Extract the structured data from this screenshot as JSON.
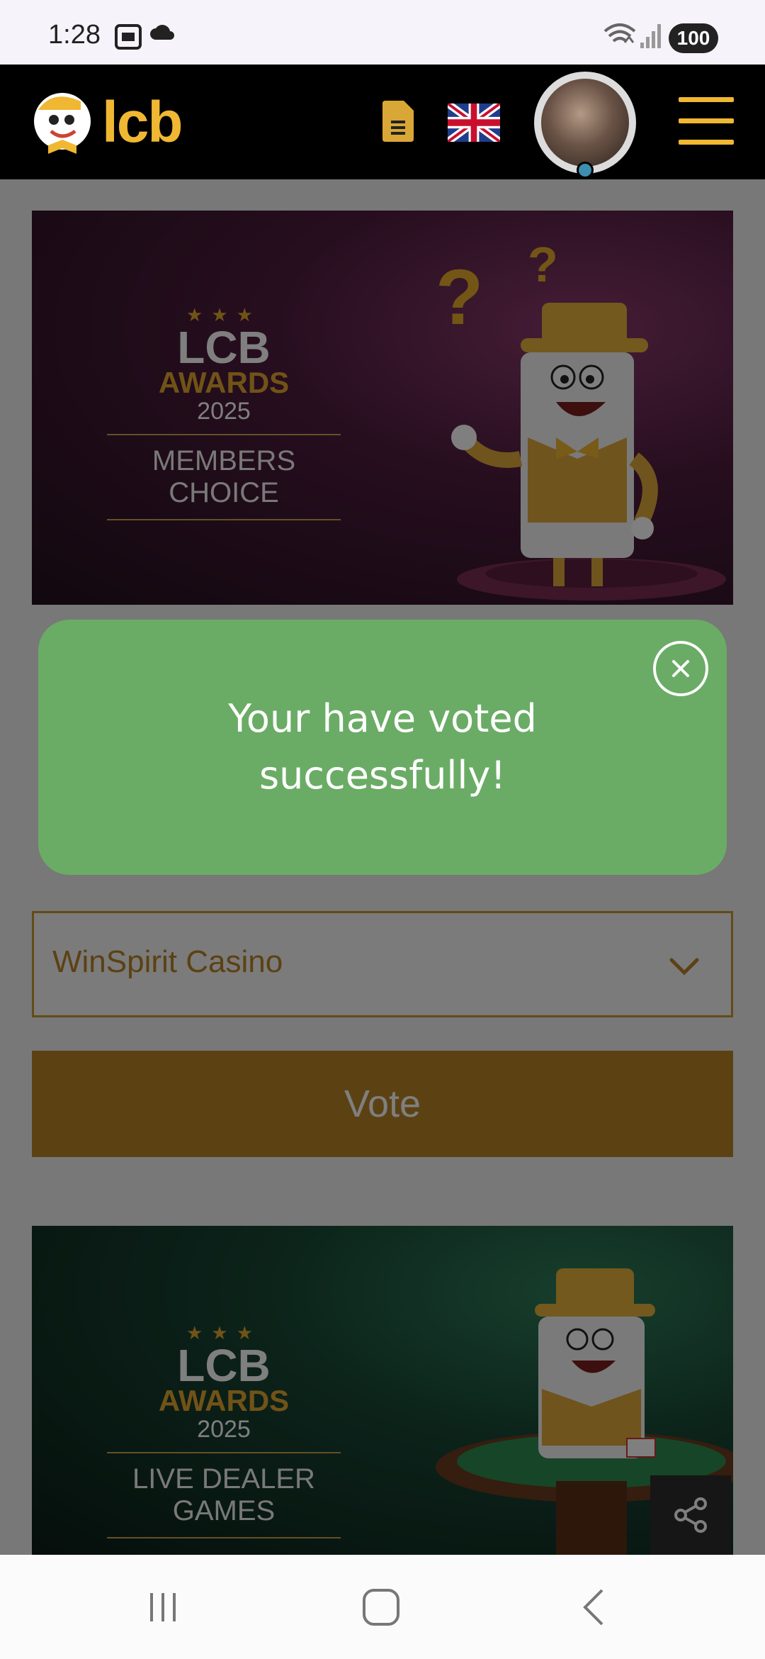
{
  "status_bar": {
    "time": "1:28",
    "battery": "100",
    "icons": [
      "screenshot-icon",
      "cloud-icon",
      "wifi-icon",
      "signal-icon"
    ]
  },
  "header": {
    "logo_text": "lcb",
    "brand_color": "#f0b733",
    "icons": [
      "document-icon",
      "uk-flag-icon",
      "avatar",
      "hamburger-menu-icon"
    ]
  },
  "banners": [
    {
      "lcb": "LCB",
      "awards": "AWARDS",
      "year": "2025",
      "category_line1": "MEMBERS",
      "category_line2": "CHOICE",
      "bg_color": "#4d1c3d"
    },
    {
      "lcb": "LCB",
      "awards": "AWARDS",
      "year": "2025",
      "category_line1": "LIVE DEALER",
      "category_line2": "GAMES",
      "bg_color": "#184735"
    }
  ],
  "vote_form": {
    "selected_casino": "WinSpirit Casino",
    "vote_label": "Vote",
    "accent_color": "#b88526"
  },
  "toast": {
    "message": "Your have voted successfully!",
    "bg_color": "#6aac65"
  },
  "nav_bar": {
    "icons": [
      "recent-apps-icon",
      "home-icon",
      "back-icon"
    ]
  }
}
